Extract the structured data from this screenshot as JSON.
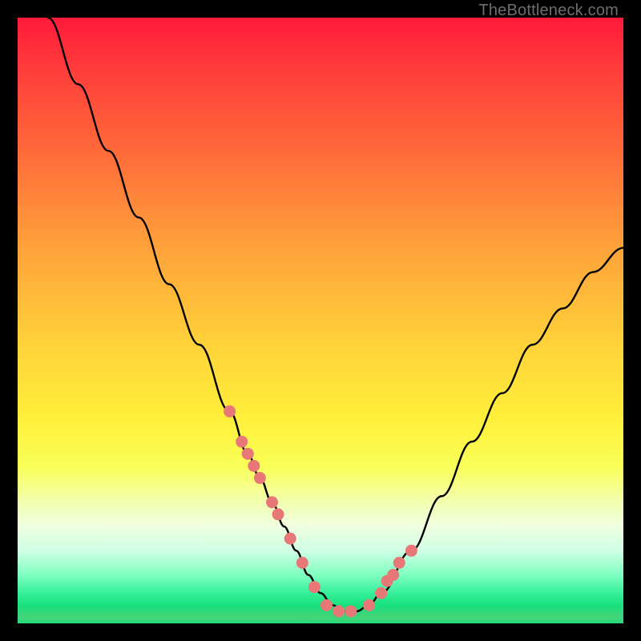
{
  "watermark": "TheBottleneck.com",
  "chart_data": {
    "type": "line",
    "title": "",
    "xlabel": "",
    "ylabel": "",
    "xlim": [
      0,
      100
    ],
    "ylim": [
      0,
      100
    ],
    "series": [
      {
        "name": "curve",
        "x": [
          5,
          10,
          15,
          20,
          25,
          30,
          35,
          38,
          40,
          42,
          44,
          46,
          48,
          50,
          52,
          54,
          56,
          58,
          60,
          65,
          70,
          75,
          80,
          85,
          90,
          95,
          100
        ],
        "y": [
          100,
          89,
          78,
          67,
          56,
          46,
          35,
          28,
          24,
          20,
          16,
          12,
          8,
          5,
          3,
          2,
          2,
          3,
          5,
          12,
          21,
          30,
          38,
          46,
          52,
          58,
          62
        ]
      }
    ],
    "markers": {
      "name": "highlight-dots",
      "x": [
        35,
        37,
        38,
        39,
        40,
        42,
        43,
        45,
        47,
        49,
        51,
        53,
        55,
        58,
        60,
        61,
        62,
        63,
        65
      ],
      "y": [
        35,
        30,
        28,
        26,
        24,
        20,
        18,
        14,
        10,
        6,
        3,
        2,
        2,
        3,
        5,
        7,
        8,
        10,
        12
      ]
    },
    "colors": {
      "curve_stroke": "#000000",
      "marker_fill": "#e87878"
    }
  }
}
